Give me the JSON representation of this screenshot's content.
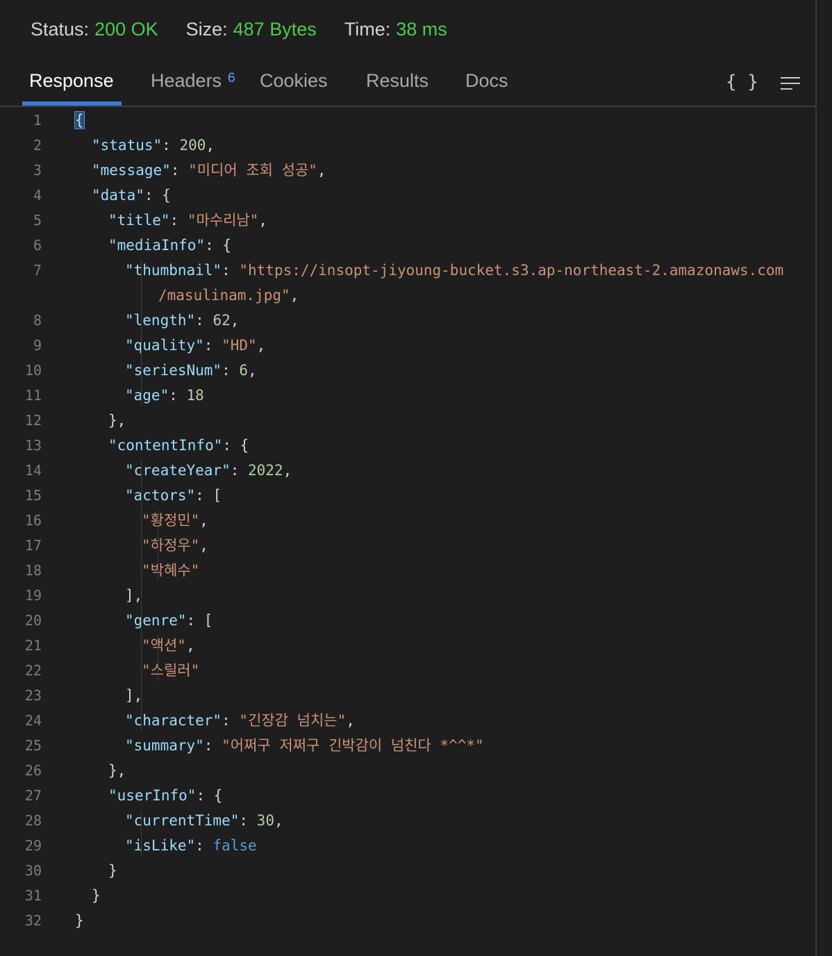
{
  "status": {
    "status_label": "Status:",
    "status_value": "200 OK",
    "size_label": "Size:",
    "size_value": "487 Bytes",
    "time_label": "Time:",
    "time_value": "38 ms"
  },
  "tabs": {
    "response": "Response",
    "headers": "Headers",
    "headers_count": "6",
    "cookies": "Cookies",
    "results": "Results",
    "docs": "Docs"
  },
  "tools": {
    "format_icon": "{ }",
    "wrap_icon": "menu-lines-icon"
  },
  "lines": [
    {
      "n": "1",
      "indent": 0,
      "t": [
        [
          "{",
          "p"
        ]
      ]
    },
    {
      "n": "2",
      "indent": 1,
      "t": [
        [
          "\"status\"",
          "k"
        ],
        [
          ": ",
          "p"
        ],
        [
          "200",
          "n"
        ],
        [
          ",",
          "p"
        ]
      ]
    },
    {
      "n": "3",
      "indent": 1,
      "t": [
        [
          "\"message\"",
          "k"
        ],
        [
          ": ",
          "p"
        ],
        [
          "\"미디어 조회 성공\"",
          "s"
        ],
        [
          ",",
          "p"
        ]
      ]
    },
    {
      "n": "4",
      "indent": 1,
      "t": [
        [
          "\"data\"",
          "k"
        ],
        [
          ": {",
          "p"
        ]
      ]
    },
    {
      "n": "5",
      "indent": 2,
      "t": [
        [
          "\"title\"",
          "k"
        ],
        [
          ": ",
          "p"
        ],
        [
          "\"마수리남\"",
          "s"
        ],
        [
          ",",
          "p"
        ]
      ]
    },
    {
      "n": "6",
      "indent": 2,
      "t": [
        [
          "\"mediaInfo\"",
          "k"
        ],
        [
          ": {",
          "p"
        ]
      ]
    },
    {
      "n": "7",
      "indent": 3,
      "t": [
        [
          "\"thumbnail\"",
          "k"
        ],
        [
          ": ",
          "p"
        ],
        [
          "\"https://insopt-jiyoung-bucket.s3.ap-northeast-2.amazonaws.com",
          "s"
        ]
      ]
    },
    {
      "n": "",
      "indent": 5,
      "t": [
        [
          "/masulinam.jpg\"",
          "s"
        ],
        [
          ",",
          "p"
        ]
      ]
    },
    {
      "n": "8",
      "indent": 3,
      "t": [
        [
          "\"length\"",
          "k"
        ],
        [
          ": ",
          "p"
        ],
        [
          "62",
          "n"
        ],
        [
          ",",
          "p"
        ]
      ]
    },
    {
      "n": "9",
      "indent": 3,
      "t": [
        [
          "\"quality\"",
          "k"
        ],
        [
          ": ",
          "p"
        ],
        [
          "\"HD\"",
          "s"
        ],
        [
          ",",
          "p"
        ]
      ]
    },
    {
      "n": "10",
      "indent": 3,
      "t": [
        [
          "\"seriesNum\"",
          "k"
        ],
        [
          ": ",
          "p"
        ],
        [
          "6",
          "n"
        ],
        [
          ",",
          "p"
        ]
      ]
    },
    {
      "n": "11",
      "indent": 3,
      "t": [
        [
          "\"age\"",
          "k"
        ],
        [
          ": ",
          "p"
        ],
        [
          "18",
          "n"
        ]
      ]
    },
    {
      "n": "12",
      "indent": 2,
      "t": [
        [
          "},",
          "p"
        ]
      ]
    },
    {
      "n": "13",
      "indent": 2,
      "t": [
        [
          "\"contentInfo\"",
          "k"
        ],
        [
          ": {",
          "p"
        ]
      ]
    },
    {
      "n": "14",
      "indent": 3,
      "t": [
        [
          "\"createYear\"",
          "k"
        ],
        [
          ": ",
          "p"
        ],
        [
          "2022",
          "n"
        ],
        [
          ",",
          "p"
        ]
      ]
    },
    {
      "n": "15",
      "indent": 3,
      "t": [
        [
          "\"actors\"",
          "k"
        ],
        [
          ": [",
          "p"
        ]
      ]
    },
    {
      "n": "16",
      "indent": 4,
      "t": [
        [
          "\"황정민\"",
          "s"
        ],
        [
          ",",
          "p"
        ]
      ]
    },
    {
      "n": "17",
      "indent": 4,
      "t": [
        [
          "\"하정우\"",
          "s"
        ],
        [
          ",",
          "p"
        ]
      ]
    },
    {
      "n": "18",
      "indent": 4,
      "t": [
        [
          "\"박혜수\"",
          "s"
        ]
      ]
    },
    {
      "n": "19",
      "indent": 3,
      "t": [
        [
          "],",
          "p"
        ]
      ]
    },
    {
      "n": "20",
      "indent": 3,
      "t": [
        [
          "\"genre\"",
          "k"
        ],
        [
          ": [",
          "p"
        ]
      ]
    },
    {
      "n": "21",
      "indent": 4,
      "t": [
        [
          "\"액션\"",
          "s"
        ],
        [
          ",",
          "p"
        ]
      ]
    },
    {
      "n": "22",
      "indent": 4,
      "t": [
        [
          "\"스릴러\"",
          "s"
        ]
      ]
    },
    {
      "n": "23",
      "indent": 3,
      "t": [
        [
          "],",
          "p"
        ]
      ]
    },
    {
      "n": "24",
      "indent": 3,
      "t": [
        [
          "\"character\"",
          "k"
        ],
        [
          ": ",
          "p"
        ],
        [
          "\"긴장감 넘치는\"",
          "s"
        ],
        [
          ",",
          "p"
        ]
      ]
    },
    {
      "n": "25",
      "indent": 3,
      "t": [
        [
          "\"summary\"",
          "k"
        ],
        [
          ": ",
          "p"
        ],
        [
          "\"어쩌구 저쩌구 긴박감이 넘친다 *^^*\"",
          "s"
        ]
      ]
    },
    {
      "n": "26",
      "indent": 2,
      "t": [
        [
          "},",
          "p"
        ]
      ]
    },
    {
      "n": "27",
      "indent": 2,
      "t": [
        [
          "\"userInfo\"",
          "k"
        ],
        [
          ": {",
          "p"
        ]
      ]
    },
    {
      "n": "28",
      "indent": 3,
      "t": [
        [
          "\"currentTime\"",
          "k"
        ],
        [
          ": ",
          "p"
        ],
        [
          "30",
          "n"
        ],
        [
          ",",
          "p"
        ]
      ]
    },
    {
      "n": "29",
      "indent": 3,
      "t": [
        [
          "\"isLike\"",
          "k"
        ],
        [
          ": ",
          "p"
        ],
        [
          "false",
          "b"
        ]
      ]
    },
    {
      "n": "30",
      "indent": 2,
      "t": [
        [
          "}",
          "p"
        ]
      ]
    },
    {
      "n": "31",
      "indent": 1,
      "t": [
        [
          "}",
          "p"
        ]
      ]
    },
    {
      "n": "32",
      "indent": 0,
      "t": [
        [
          "}",
          "p"
        ]
      ]
    }
  ]
}
